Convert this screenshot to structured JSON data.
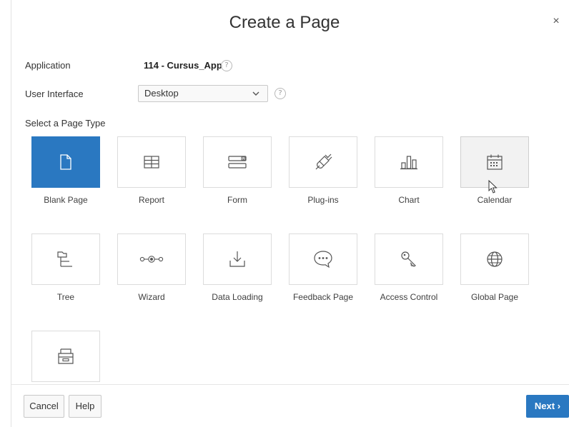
{
  "dialog": {
    "title": "Create a Page",
    "close_glyph": "×"
  },
  "fields": {
    "application_label": "Application",
    "application_value": "114 - Cursus_App",
    "user_interface_label": "User Interface",
    "user_interface_value": "Desktop",
    "help_glyph": "?",
    "select_chevron": "⌄"
  },
  "page_types": {
    "section_label": "Select a Page Type",
    "selected": "Blank Page",
    "hovered": "Calendar",
    "items": [
      {
        "label": "Blank Page",
        "icon": "blank-page-icon"
      },
      {
        "label": "Report",
        "icon": "report-table-icon"
      },
      {
        "label": "Form",
        "icon": "form-icon"
      },
      {
        "label": "Plug-ins",
        "icon": "plug-icon"
      },
      {
        "label": "Chart",
        "icon": "bar-chart-icon"
      },
      {
        "label": "Calendar",
        "icon": "calendar-icon"
      },
      {
        "label": "Tree",
        "icon": "tree-icon"
      },
      {
        "label": "Wizard",
        "icon": "wizard-steps-icon"
      },
      {
        "label": "Data Loading",
        "icon": "download-tray-icon"
      },
      {
        "label": "Feedback Page",
        "icon": "speech-bubble-icon"
      },
      {
        "label": "Access Control",
        "icon": "key-icon"
      },
      {
        "label": "Global Page",
        "icon": "globe-icon"
      },
      {
        "label": "",
        "icon": "archive-box-icon"
      }
    ]
  },
  "footer": {
    "cancel_label": "Cancel",
    "help_label": "Help",
    "next_label": "Next",
    "next_glyph": "›"
  },
  "colors": {
    "accent": "#2a78c1",
    "hover_tile": "#f2f2f2",
    "border": "#dcdcdc"
  }
}
